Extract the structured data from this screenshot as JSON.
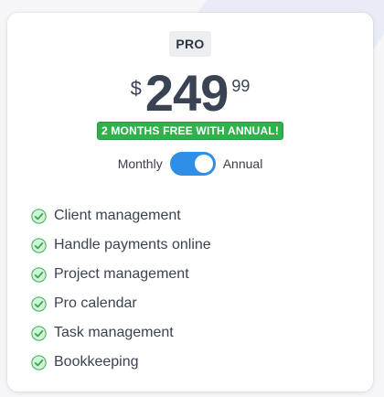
{
  "colors": {
    "accent_blue": "#2f8fe6",
    "promo_green": "#2fb24c",
    "check_green": "#2fb24c",
    "text_dark": "#3a4354",
    "badge_bg": "#eceef1"
  },
  "plan": {
    "name": "PRO"
  },
  "price": {
    "currency": "$",
    "amount": "249",
    "cents": "99"
  },
  "promo": {
    "text": "2 MONTHS FREE WITH ANNUAL!"
  },
  "billing_toggle": {
    "left_label": "Monthly",
    "right_label": "Annual",
    "selected": "Annual"
  },
  "features": [
    {
      "label": "Client management",
      "icon": "check-circle-icon"
    },
    {
      "label": "Handle payments online",
      "icon": "check-circle-icon"
    },
    {
      "label": "Project management",
      "icon": "check-circle-icon"
    },
    {
      "label": "Pro calendar",
      "icon": "check-circle-icon"
    },
    {
      "label": "Task management",
      "icon": "check-circle-icon"
    },
    {
      "label": "Bookkeeping",
      "icon": "check-circle-icon"
    }
  ]
}
